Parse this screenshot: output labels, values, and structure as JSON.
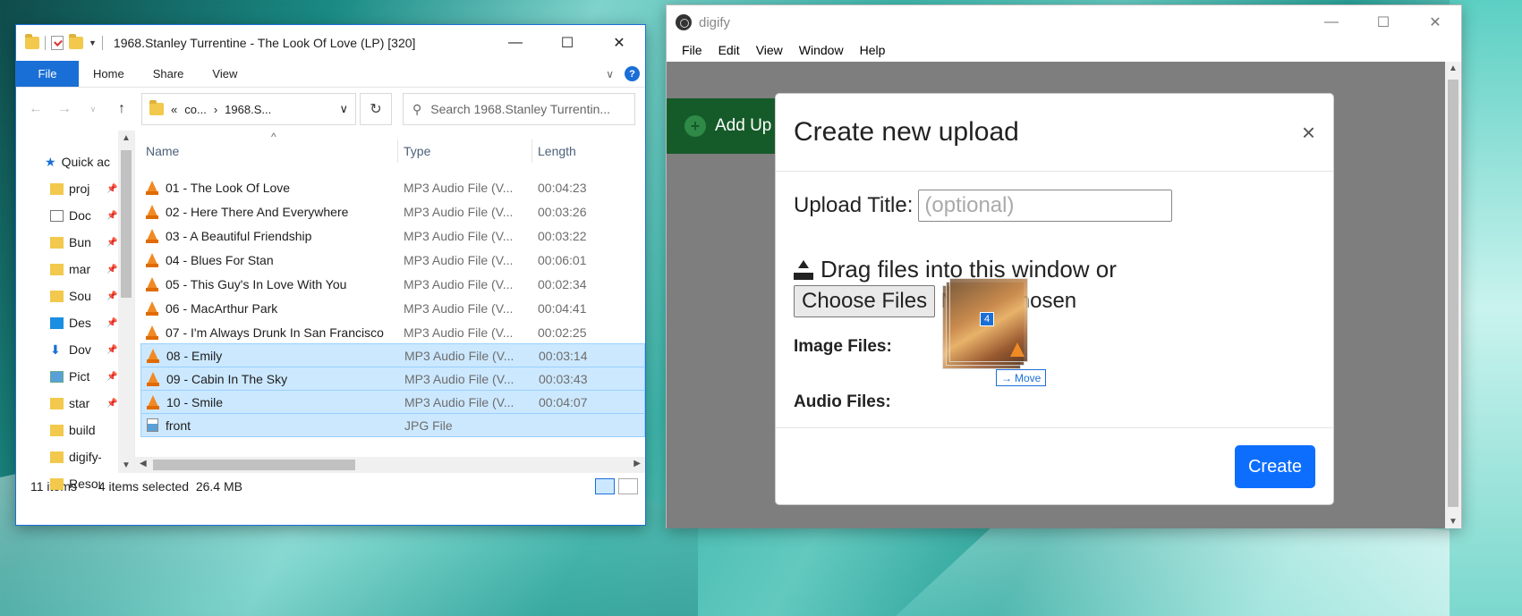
{
  "explorer": {
    "title": "1968.Stanley Turrentine - The Look Of Love (LP) [320]",
    "ribbon": {
      "file": "File",
      "home": "Home",
      "share": "Share",
      "view": "View",
      "help": "?"
    },
    "address": {
      "prefix": "«",
      "part1": "co...",
      "separator": "›",
      "part2": "1968.S..."
    },
    "search_placeholder": "Search 1968.Stanley Turrentin...",
    "nav_items": [
      {
        "label": "Quick ac",
        "icon": "star-icon"
      },
      {
        "label": "proj",
        "icon": "folder-icon"
      },
      {
        "label": "Doc",
        "icon": "document-icon"
      },
      {
        "label": "Bun",
        "icon": "folder-icon"
      },
      {
        "label": "mar",
        "icon": "folder-icon"
      },
      {
        "label": "Sou",
        "icon": "folder-icon"
      },
      {
        "label": "Des",
        "icon": "desktop-icon"
      },
      {
        "label": "Dov",
        "icon": "download-icon"
      },
      {
        "label": "Pict",
        "icon": "pictures-icon"
      },
      {
        "label": "star",
        "icon": "folder-icon"
      },
      {
        "label": "build",
        "icon": "folder-icon"
      },
      {
        "label": "digify-",
        "icon": "folder-icon"
      },
      {
        "label": "Resour",
        "icon": "folder-icon"
      }
    ],
    "columns": {
      "name": "Name",
      "type": "Type",
      "length": "Length"
    },
    "files": [
      {
        "name": "01 - The Look Of Love",
        "type": "MP3 Audio File (V...",
        "length": "00:04:23",
        "selected": false
      },
      {
        "name": "02 - Here There And Everywhere",
        "type": "MP3 Audio File (V...",
        "length": "00:03:26",
        "selected": false
      },
      {
        "name": "03 - A Beautiful Friendship",
        "type": "MP3 Audio File (V...",
        "length": "00:03:22",
        "selected": false
      },
      {
        "name": "04 - Blues For Stan",
        "type": "MP3 Audio File (V...",
        "length": "00:06:01",
        "selected": false
      },
      {
        "name": "05 - This Guy's In Love With You",
        "type": "MP3 Audio File (V...",
        "length": "00:02:34",
        "selected": false
      },
      {
        "name": "06 - MacArthur Park",
        "type": "MP3 Audio File (V...",
        "length": "00:04:41",
        "selected": false
      },
      {
        "name": "07 - I'm Always Drunk In San Francisco",
        "type": "MP3 Audio File (V...",
        "length": "00:02:25",
        "selected": false
      },
      {
        "name": "08 - Emily",
        "type": "MP3 Audio File (V...",
        "length": "00:03:14",
        "selected": true
      },
      {
        "name": "09 - Cabin In The Sky",
        "type": "MP3 Audio File (V...",
        "length": "00:03:43",
        "selected": true
      },
      {
        "name": "10 - Smile",
        "type": "MP3 Audio File (V...",
        "length": "00:04:07",
        "selected": true
      },
      {
        "name": "front",
        "type": "JPG File",
        "length": "",
        "selected": true
      }
    ],
    "status": {
      "count": "11 items",
      "selected": "4 items selected",
      "size": "26.4 MB"
    }
  },
  "digify": {
    "title": "digify",
    "menu": [
      "File",
      "Edit",
      "View",
      "Window",
      "Help"
    ],
    "add_upload": "Add Up",
    "modal": {
      "title": "Create new upload",
      "close": "×",
      "upload_title_label": "Upload Title:",
      "upload_title_placeholder": "(optional)",
      "drag_text": "Drag files into this window or",
      "choose_button": "Choose Files",
      "no_file": "No file chosen",
      "image_files_label": "Image Files:",
      "audio_files_label": "Audio Files:",
      "create_button": "Create"
    }
  },
  "drag": {
    "count": "4",
    "action": "Move"
  }
}
